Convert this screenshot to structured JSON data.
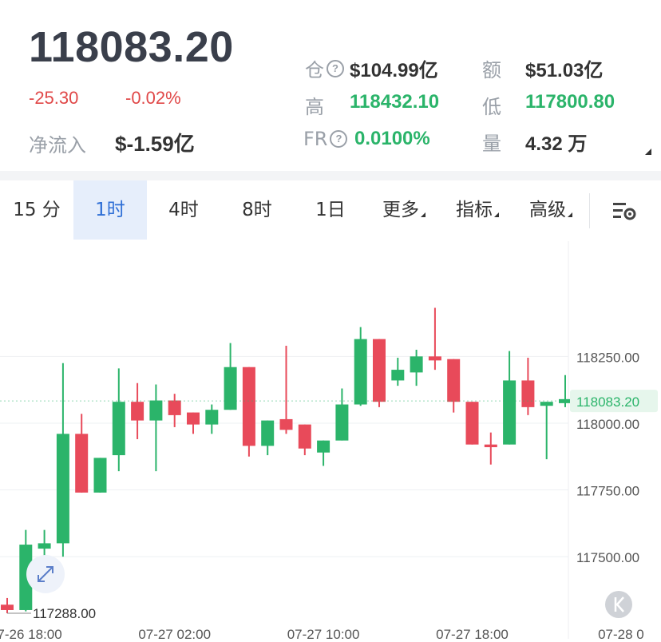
{
  "header": {
    "price": "118083.20",
    "change": "-25.30",
    "change_pct": "-0.02%",
    "net_inflow_label": "净流入",
    "net_inflow_value": "$-1.59亿",
    "stats": {
      "oi_label": "仓",
      "oi_value": "$104.99亿",
      "turnover_label": "额",
      "turnover_value": "$51.03亿",
      "high_label": "高",
      "high_value": "118432.10",
      "low_label": "低",
      "low_value": "117800.80",
      "fr_label": "FR",
      "fr_value": "0.0100%",
      "volume_label": "量",
      "volume_value": "4.32 万"
    }
  },
  "tabs": [
    {
      "label": "15 分"
    },
    {
      "label": "1时",
      "active": true
    },
    {
      "label": "4时"
    },
    {
      "label": "8时"
    },
    {
      "label": "1日"
    },
    {
      "label": "更多"
    },
    {
      "label": "指标"
    },
    {
      "label": "高级"
    }
  ],
  "colors": {
    "up": "#2bb46a",
    "down": "#e84a5a",
    "active_tab_bg": "#e6eefb",
    "active_tab_text": "#2f6fd6"
  },
  "icons": {
    "settings": "chart-settings-icon",
    "expand": "expand-icon",
    "back_to_latest": "back-to-latest-icon"
  },
  "chart_data": {
    "type": "candlestick",
    "interval": "1时",
    "y_ticks": [
      "118250.00",
      "118000.00",
      "117750.00",
      "117500.00"
    ],
    "y_tick_values": [
      118250,
      118000,
      117750,
      117500
    ],
    "ylim": [
      117270,
      118610
    ],
    "x_ticks": [
      "07-26 18:00",
      "07-27 02:00",
      "07-27 10:00",
      "07-27 18:00",
      "07-28 0"
    ],
    "x_tick_indices": [
      1,
      9,
      17,
      25,
      33
    ],
    "last_price_label": "118083.20",
    "last_price": 118083.2,
    "max_annotation": "118432.10",
    "max_annotation_value": 118432.1,
    "min_annotation": "117288.00",
    "min_annotation_value": 117288,
    "candles": [
      {
        "o": 117320,
        "c": 117300,
        "h": 117345,
        "l": 117288
      },
      {
        "o": 117300,
        "c": 117545,
        "h": 117600,
        "l": 117295
      },
      {
        "o": 117530,
        "c": 117550,
        "h": 117600,
        "l": 117460
      },
      {
        "o": 117550,
        "c": 117960,
        "h": 118225,
        "l": 117500
      },
      {
        "o": 117960,
        "c": 117740,
        "h": 118035,
        "l": 117740
      },
      {
        "o": 117740,
        "c": 117870,
        "h": 117870,
        "l": 117740
      },
      {
        "o": 117880,
        "c": 118080,
        "h": 118205,
        "l": 117820
      },
      {
        "o": 118080,
        "c": 118010,
        "h": 118150,
        "l": 117940
      },
      {
        "o": 118010,
        "c": 118085,
        "h": 118145,
        "l": 117820
      },
      {
        "o": 118085,
        "c": 118030,
        "h": 118110,
        "l": 117985
      },
      {
        "o": 118040,
        "c": 117995,
        "h": 118040,
        "l": 117960
      },
      {
        "o": 117995,
        "c": 118050,
        "h": 118070,
        "l": 117960
      },
      {
        "o": 118050,
        "c": 118210,
        "h": 118300,
        "l": 118050
      },
      {
        "o": 118210,
        "c": 117915,
        "h": 118210,
        "l": 117875
      },
      {
        "o": 117915,
        "c": 118010,
        "h": 118010,
        "l": 117880
      },
      {
        "o": 118015,
        "c": 117975,
        "h": 118290,
        "l": 117960
      },
      {
        "o": 117995,
        "c": 117905,
        "h": 117995,
        "l": 117880
      },
      {
        "o": 117890,
        "c": 117935,
        "h": 117935,
        "l": 117840
      },
      {
        "o": 117935,
        "c": 118070,
        "h": 118130,
        "l": 117935
      },
      {
        "o": 118070,
        "c": 118315,
        "h": 118360,
        "l": 118065
      },
      {
        "o": 118315,
        "c": 118080,
        "h": 118315,
        "l": 118060
      },
      {
        "o": 118160,
        "c": 118200,
        "h": 118245,
        "l": 118140
      },
      {
        "o": 118190,
        "c": 118250,
        "h": 118275,
        "l": 118140
      },
      {
        "o": 118250,
        "c": 118235,
        "h": 118432,
        "l": 118200
      },
      {
        "o": 118240,
        "c": 118080,
        "h": 118240,
        "l": 118040
      },
      {
        "o": 118080,
        "c": 117920,
        "h": 118080,
        "l": 117920
      },
      {
        "o": 117920,
        "c": 117910,
        "h": 117965,
        "l": 117845
      },
      {
        "o": 117920,
        "c": 118160,
        "h": 118270,
        "l": 117920
      },
      {
        "o": 118160,
        "c": 118060,
        "h": 118245,
        "l": 118030
      },
      {
        "o": 118065,
        "c": 118080,
        "h": 118080,
        "l": 117865
      },
      {
        "o": 118075,
        "c": 118090,
        "h": 118180,
        "l": 118060
      }
    ]
  }
}
